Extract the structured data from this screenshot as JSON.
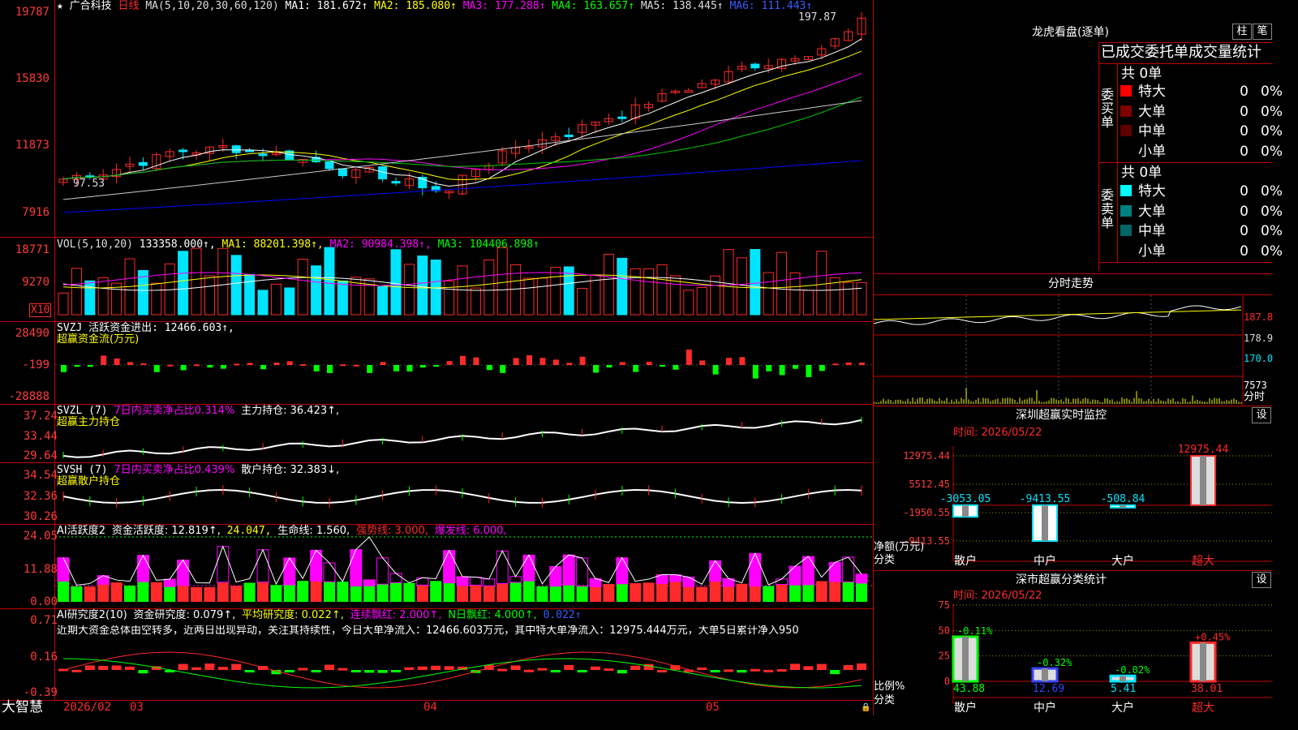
{
  "colors": {
    "up": "#ff2a2a",
    "down": "#00e5ff",
    "ma1": "#ffffff",
    "ma2": "#ffff00",
    "ma3": "#ff00ff",
    "ma4": "#00cc00",
    "ma5": "#cccccc",
    "ma6": "#0000ff",
    "green": "#00ff00",
    "grid": "#c00000"
  },
  "main": {
    "star_icon": "★",
    "name": "广合科技",
    "period": "日线",
    "ma_title": "MA(5,10,20,30,60,120)",
    "ma1": "MA1: 181.672↑",
    "ma2": "MA2: 185.080↑",
    "ma3": "MA3: 177.288↑",
    "ma4": "MA4: 163.657↑",
    "ma5": "MA5: 138.445↑",
    "ma6": "MA6: 111.443↑",
    "y_labels": [
      "19787",
      "15830",
      "11873",
      "7916"
    ],
    "high_mark": "197.87",
    "low_mark": "97.53",
    "x10": "X10"
  },
  "vol": {
    "title": "VOL(5,10,20)",
    "value": "133358.000↑,",
    "ma1": "MA1: 88201.398↑,",
    "ma2": "MA2: 90984.398↑,",
    "ma3": "MA3: 104406.898↑",
    "y_labels": [
      "18771",
      "9270"
    ]
  },
  "svzj": {
    "title": "SVZJ  活跃资金进出: 12466.603↑,",
    "sub": "超赢资金流(万元)",
    "y_labels": [
      "28490",
      "-199",
      "-28888"
    ]
  },
  "svzl": {
    "title": "SVZL  (7)",
    "pct": "7日内买卖净占比0.314%",
    "val": "主力持仓: 36.423↑,",
    "sub": "超赢主力持仓",
    "y_labels": [
      "37.24",
      "33.44",
      "29.64"
    ]
  },
  "svsh": {
    "title": "SVSH  (7)",
    "pct": "7日内买卖净占比0.439%",
    "val": "散户持仓: 32.383↓,",
    "sub": "超赢散户持仓",
    "y_labels": [
      "34.54",
      "32.36",
      "30.26"
    ]
  },
  "ai1": {
    "title": "AI活跃度2",
    "a": "资金活跃度: 12.819↑,",
    "b": "24.047,",
    "c": "生命线: 1.560,",
    "d": "强势线: 3.000,",
    "e": "爆发线: 6.000,",
    "y_labels": [
      "24.05",
      "11.88",
      "0.00"
    ]
  },
  "ai2": {
    "title": "AI研究度2(10)",
    "a": "资金研究度: 0.079↑,",
    "b": "平均研究度: 0.022↑,",
    "c": "连续飘红: 2.000↑,",
    "d": "N日飘红: 4.000↑,",
    "e": "0.022↑",
    "text": "近期大资金总体由空转多，近两日出现异动，关注其持续性，今日大单净流入：12466.603万元，其中特大单净流入：12975.444万元，大单5日累计净入950",
    "y_labels": [
      "0.71",
      "0.16",
      "-0.39"
    ]
  },
  "footer": {
    "brand": "大智慧",
    "dates": [
      "2026/02",
      "03",
      "04",
      "05"
    ],
    "lock_icon": "🔒"
  },
  "lhb": {
    "title": "龙虎看盘(逐单)",
    "btn1": "柱",
    "btn2": "笔",
    "subtitle": "已成交委托单成交量统计",
    "buy": {
      "side": "委买单",
      "total": "共 0单",
      "rows": [
        {
          "name": "特大",
          "v": "0",
          "p": "0%"
        },
        {
          "name": "大单",
          "v": "0",
          "p": "0%"
        },
        {
          "name": "中单",
          "v": "0",
          "p": "0%"
        },
        {
          "name": "小单",
          "v": "0",
          "p": "0%"
        }
      ]
    },
    "sell": {
      "side": "委卖单",
      "total": "共 0单",
      "rows": [
        {
          "name": "特大",
          "v": "0",
          "p": "0%"
        },
        {
          "name": "大单",
          "v": "0",
          "p": "0%"
        },
        {
          "name": "中单",
          "v": "0",
          "p": "0%"
        },
        {
          "name": "小单",
          "v": "0",
          "p": "0%"
        }
      ]
    }
  },
  "intraday": {
    "title": "分时走势",
    "y_labels": [
      "187.8",
      "178.9",
      "170.0"
    ],
    "vol_label": "7573",
    "vol_sub": "分时"
  },
  "monitor": {
    "title": "深圳超赢实时监控",
    "btn": "设",
    "time": "时间: 2026/05/22",
    "y_labels": [
      "12975.44",
      "5512.45",
      "-1950.55",
      "-9413.55"
    ],
    "ylabel": "净额(万元)",
    "xlabel": "分类",
    "cats": [
      "散户",
      "中户",
      "大户",
      "超大"
    ],
    "values": [
      -3053.05,
      -9413.55,
      -508.84,
      12975.44
    ],
    "value_labels": [
      "-3053.05",
      "-9413.55",
      "-508.84",
      "12975.44"
    ]
  },
  "class": {
    "title": "深市超赢分类统计",
    "btn": "设",
    "time": "时间: 2026/05/22",
    "y_labels": [
      "75",
      "50",
      "25",
      "0"
    ],
    "ylabel": "比例%",
    "xlabel": "分类",
    "cats": [
      "散户",
      "中户",
      "大户",
      "超大"
    ],
    "values": [
      43.88,
      12.69,
      5.41,
      38.01
    ],
    "value_labels": [
      "43.88",
      "12.69",
      "5.41",
      "38.01"
    ],
    "changes": [
      "-0.11%",
      "-0.32%",
      "-0.02%",
      "+0.45%"
    ]
  }
}
